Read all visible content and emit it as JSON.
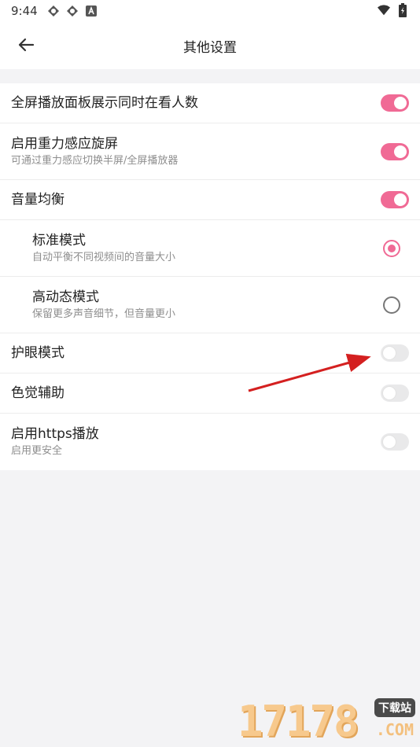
{
  "status_bar": {
    "time": "9:44",
    "left_icons": [
      "navigation-icon",
      "navigation-icon",
      "text-icon"
    ],
    "right_icons": [
      "wifi-icon",
      "battery-icon"
    ]
  },
  "app_bar": {
    "title": "其他设置",
    "back_icon": "back-arrow-icon"
  },
  "settings": [
    {
      "title": "全屏播放面板展示同时在看人数",
      "subtitle": "",
      "control": "toggle",
      "on": true
    },
    {
      "title": "启用重力感应旋屏",
      "subtitle": "可通过重力感应切换半屏/全屏播放器",
      "control": "toggle",
      "on": true
    },
    {
      "title": "音量均衡",
      "subtitle": "",
      "control": "toggle",
      "on": true
    },
    {
      "title": "标准模式",
      "subtitle": "自动平衡不同视频间的音量大小",
      "control": "radio",
      "checked": true
    },
    {
      "title": "高动态模式",
      "subtitle": "保留更多声音细节，但音量更小",
      "control": "radio",
      "checked": false
    },
    {
      "title": "护眼模式",
      "subtitle": "",
      "control": "toggle",
      "on": false
    },
    {
      "title": "色觉辅助",
      "subtitle": "",
      "control": "toggle",
      "on": false
    },
    {
      "title": "启用https播放",
      "subtitle": "启用更安全",
      "control": "toggle",
      "on": false
    }
  ],
  "colors": {
    "accent": "#f06a95",
    "toggle_off": "#e9e9ea",
    "background": "#f3f3f5",
    "annotation_arrow": "#d42020"
  },
  "watermark": {
    "digits": "17178",
    "badge": "下载站",
    "domain": ".COM"
  }
}
